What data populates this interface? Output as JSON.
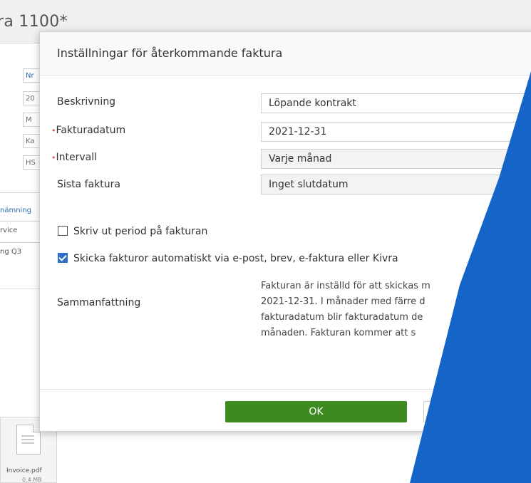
{
  "background": {
    "title": "ra 1100*",
    "fields": [
      "Nr",
      "20",
      "M",
      "Ka",
      "HS"
    ],
    "table": {
      "header": "nämning",
      "rows": [
        "rvice",
        "ng Q3"
      ]
    },
    "attachment": {
      "name": "Invoice.pdf",
      "size": "0.4 MB"
    }
  },
  "modal": {
    "title": "Inställningar för återkommande faktura",
    "fields": [
      {
        "label": "Beskrivning",
        "value": "Löpande kontrakt",
        "required": false
      },
      {
        "label": "Fakturadatum",
        "value": "2021-12-31",
        "required": true
      },
      {
        "label": "Intervall",
        "value": "Varje månad",
        "required": true
      },
      {
        "label": "Sista faktura",
        "value": "Inget slutdatum",
        "required": false
      }
    ],
    "required_marker": "•",
    "checkboxes": [
      {
        "label": "Skriv ut period på fakturan",
        "checked": false
      },
      {
        "label": "Skicka fakturor automatiskt via e-post, brev, e-faktura eller Kivra",
        "checked": true
      }
    ],
    "summary": {
      "label": "Sammanfattning",
      "lines": [
        "Fakturan är inställd för att skickas m",
        "2021-12-31. I månader med färre d",
        "fakturadatum blir fakturadatum de",
        "månaden. Fakturan kommer att s"
      ]
    },
    "ok_label": "OK"
  },
  "colors": {
    "ok_button": "#3d8a1f",
    "overlay_blue": "#1565c9",
    "checkbox_checked": "#2f6ec8",
    "required_marker": "#d9534f"
  }
}
